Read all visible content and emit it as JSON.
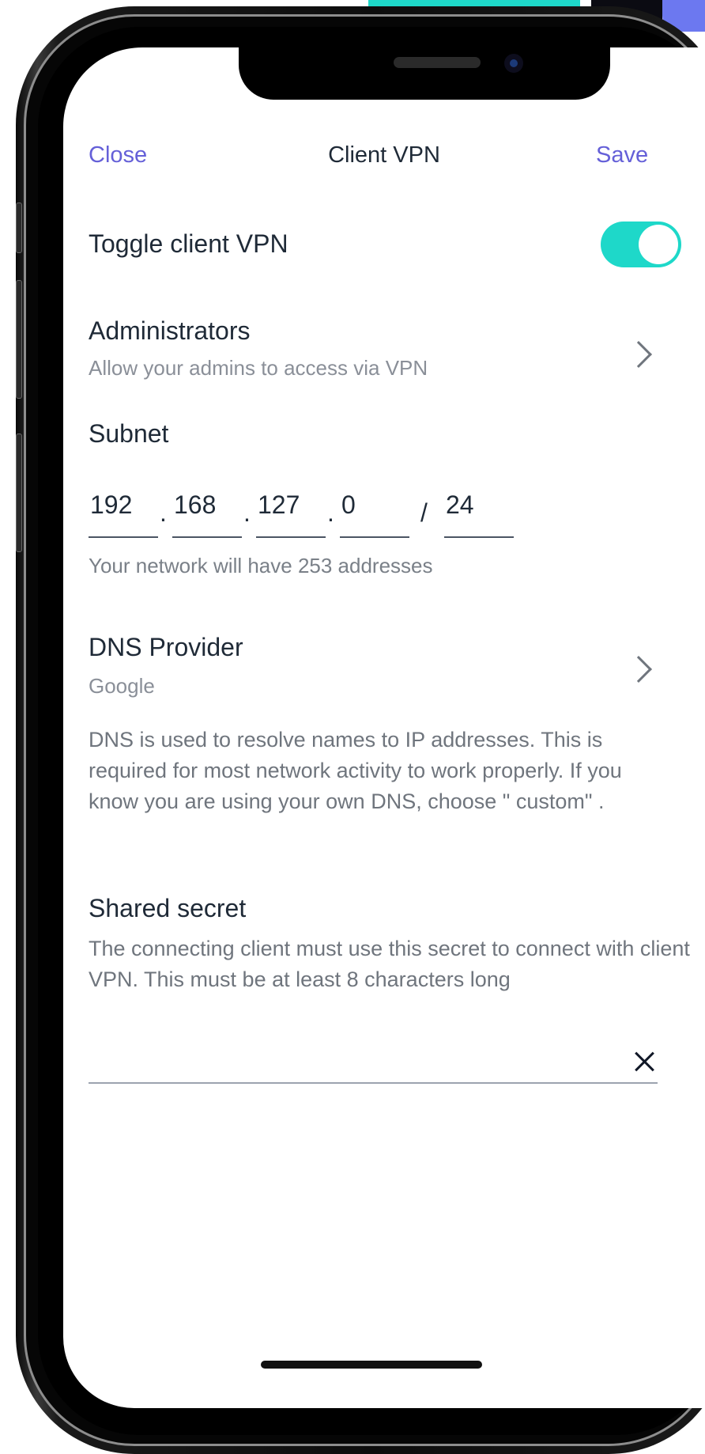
{
  "header": {
    "close_label": "Close",
    "title": "Client VPN",
    "save_label": "Save"
  },
  "toggle": {
    "label": "Toggle client VPN",
    "enabled": true
  },
  "administrators": {
    "label": "Administrators",
    "description": "Allow your admins to access via VPN"
  },
  "subnet": {
    "label": "Subnet",
    "octet1": "192",
    "octet2": "168",
    "octet3": "127",
    "octet4": "0",
    "mask": "24",
    "note": "Your network will have 253 addresses"
  },
  "dns": {
    "label": "DNS Provider",
    "value": "Google",
    "description": "DNS is used to resolve names to IP addresses. This is required for most network activity to work properly. If you know you are using your own DNS, choose \" custom\" ."
  },
  "secret": {
    "label": "Shared secret",
    "description": "The connecting client must use this secret to connect with client VPN. This must be at least 8 characters long",
    "value": ""
  },
  "colors": {
    "accent": "#6560D8",
    "toggle_on": "#1ED8C9",
    "text_primary": "#1f2a37",
    "text_secondary": "#8a8f98"
  },
  "icons": {
    "admin_chevron": "chevron-right-icon",
    "dns_chevron": "chevron-right-icon",
    "clear": "close-icon"
  }
}
